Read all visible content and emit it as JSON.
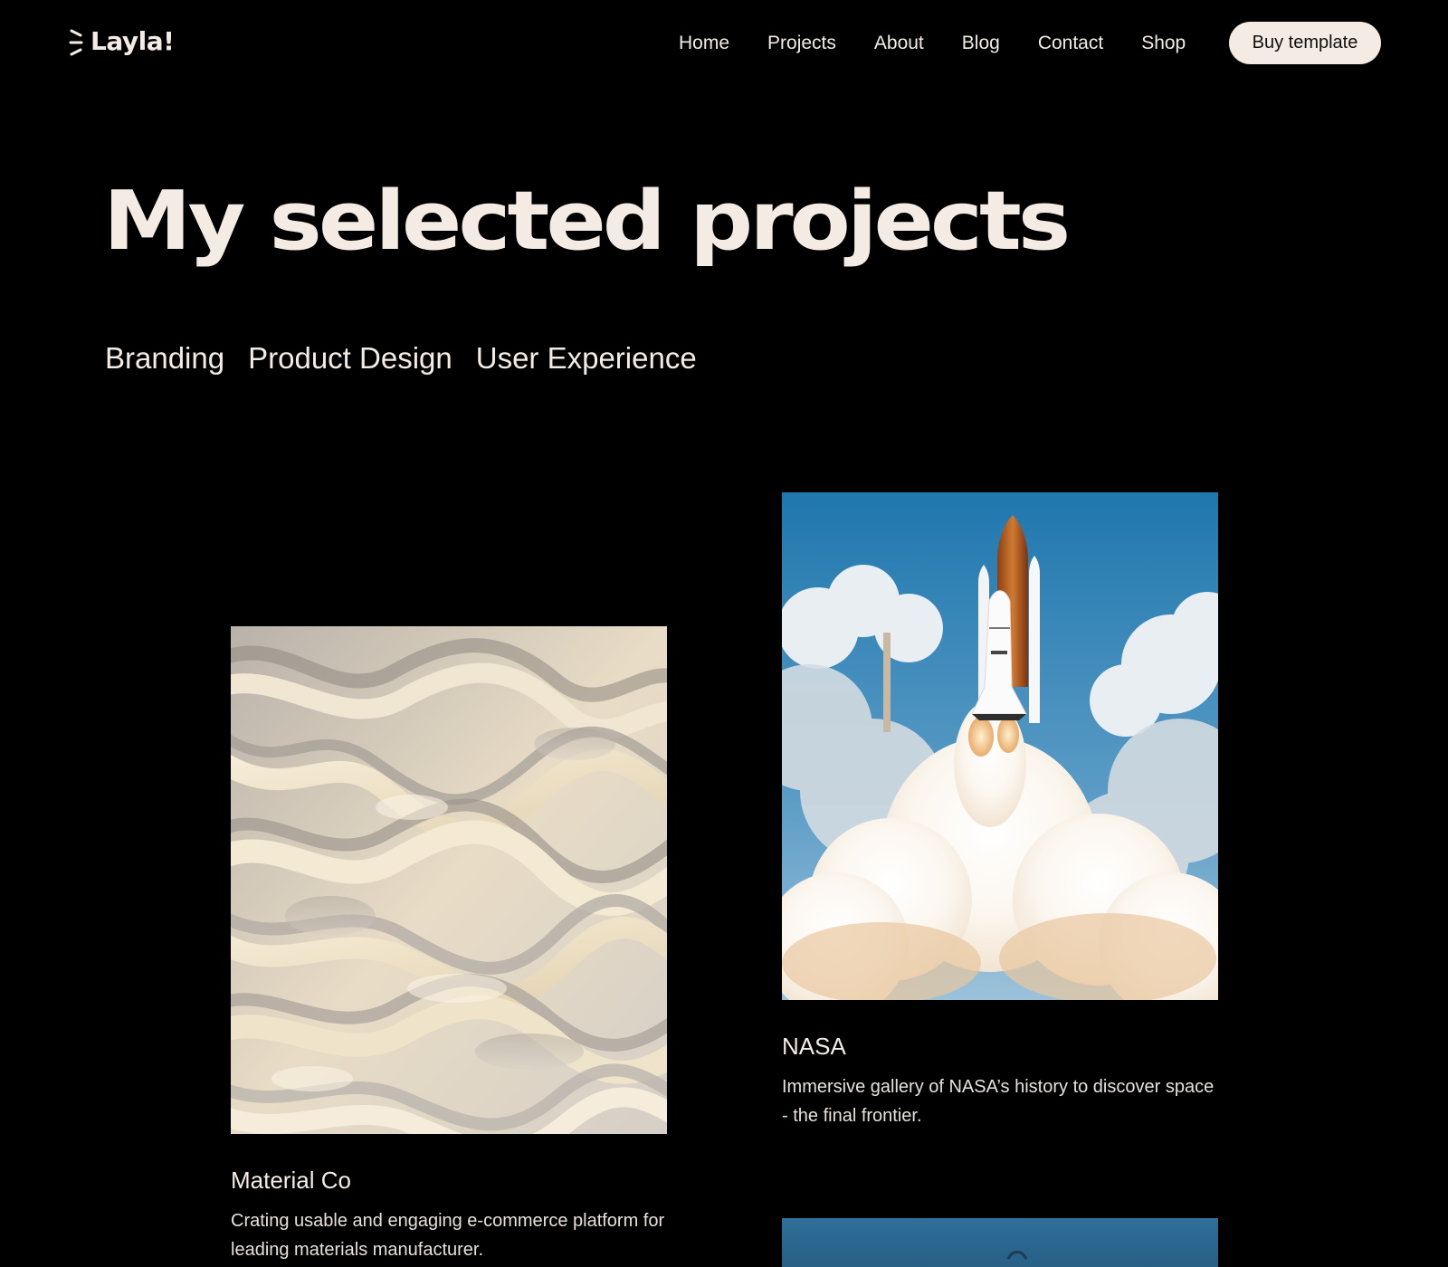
{
  "header": {
    "logo_text": "Layla!",
    "nav": [
      "Home",
      "Projects",
      "About",
      "Blog",
      "Contact",
      "Shop"
    ],
    "buy_label": "Buy template"
  },
  "hero": {
    "title": "My selected projects"
  },
  "filters": [
    "Branding",
    "Product Design",
    "User Experience"
  ],
  "projects": [
    {
      "title": "Material Co",
      "description": "Crating usable and engaging e-commerce platform for leading materials manufacturer.",
      "image": "abstract-paper-folds"
    },
    {
      "title": "NASA",
      "description": "Immersive gallery of NASA’s history to discover space - the final frontier.",
      "image": "space-shuttle-launch"
    }
  ],
  "colors": {
    "background": "#000000",
    "text": "#f4ebe4",
    "button_bg": "#f4ebe4",
    "button_text": "#111111"
  }
}
